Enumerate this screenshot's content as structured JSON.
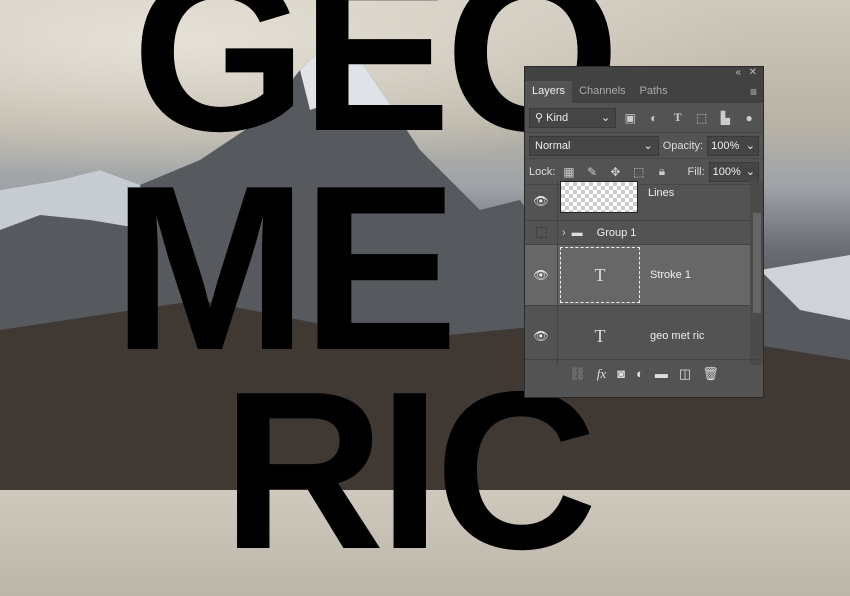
{
  "canvas": {
    "lines": [
      "GEO",
      "ME",
      "RIC"
    ]
  },
  "panel": {
    "tabs": [
      "Layers",
      "Channels",
      "Paths"
    ],
    "filter": "Kind",
    "blend_mode": "Normal",
    "opacity_label": "Opacity:",
    "opacity": "100%",
    "lock_label": "Lock:",
    "fill_label": "Fill:",
    "fill": "100%",
    "layers": [
      {
        "name": "Lines",
        "visible": true,
        "type": "raster"
      },
      {
        "name": "Group 1",
        "visible": false,
        "type": "group"
      },
      {
        "name": "Stroke 1",
        "visible": true,
        "type": "text",
        "selected": true
      },
      {
        "name": "geo met ric",
        "visible": true,
        "type": "text"
      }
    ]
  }
}
